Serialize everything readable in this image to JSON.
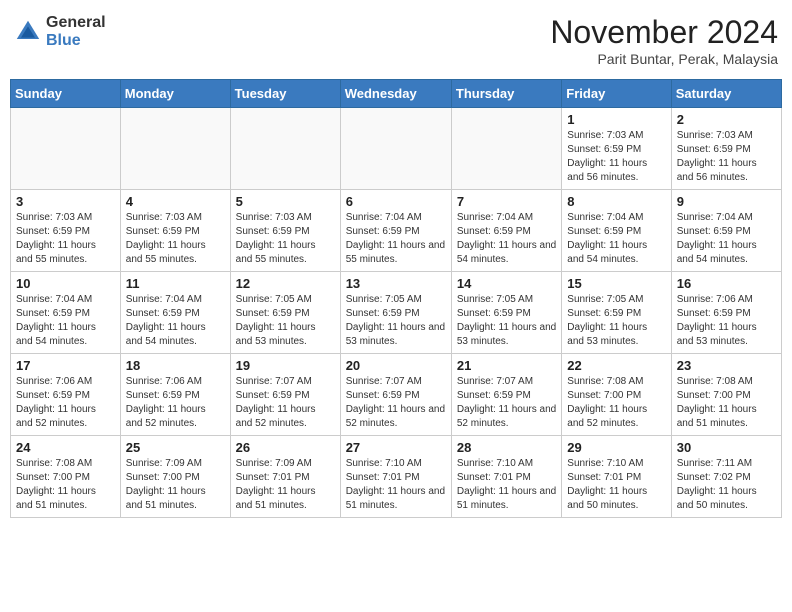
{
  "header": {
    "logo_general": "General",
    "logo_blue": "Blue",
    "title": "November 2024",
    "subtitle": "Parit Buntar, Perak, Malaysia"
  },
  "weekdays": [
    "Sunday",
    "Monday",
    "Tuesday",
    "Wednesday",
    "Thursday",
    "Friday",
    "Saturday"
  ],
  "weeks": [
    [
      {
        "day": "",
        "info": ""
      },
      {
        "day": "",
        "info": ""
      },
      {
        "day": "",
        "info": ""
      },
      {
        "day": "",
        "info": ""
      },
      {
        "day": "",
        "info": ""
      },
      {
        "day": "1",
        "info": "Sunrise: 7:03 AM\nSunset: 6:59 PM\nDaylight: 11 hours\nand 56 minutes."
      },
      {
        "day": "2",
        "info": "Sunrise: 7:03 AM\nSunset: 6:59 PM\nDaylight: 11 hours\nand 56 minutes."
      }
    ],
    [
      {
        "day": "3",
        "info": "Sunrise: 7:03 AM\nSunset: 6:59 PM\nDaylight: 11 hours\nand 55 minutes."
      },
      {
        "day": "4",
        "info": "Sunrise: 7:03 AM\nSunset: 6:59 PM\nDaylight: 11 hours\nand 55 minutes."
      },
      {
        "day": "5",
        "info": "Sunrise: 7:03 AM\nSunset: 6:59 PM\nDaylight: 11 hours\nand 55 minutes."
      },
      {
        "day": "6",
        "info": "Sunrise: 7:04 AM\nSunset: 6:59 PM\nDaylight: 11 hours\nand 55 minutes."
      },
      {
        "day": "7",
        "info": "Sunrise: 7:04 AM\nSunset: 6:59 PM\nDaylight: 11 hours\nand 54 minutes."
      },
      {
        "day": "8",
        "info": "Sunrise: 7:04 AM\nSunset: 6:59 PM\nDaylight: 11 hours\nand 54 minutes."
      },
      {
        "day": "9",
        "info": "Sunrise: 7:04 AM\nSunset: 6:59 PM\nDaylight: 11 hours\nand 54 minutes."
      }
    ],
    [
      {
        "day": "10",
        "info": "Sunrise: 7:04 AM\nSunset: 6:59 PM\nDaylight: 11 hours\nand 54 minutes."
      },
      {
        "day": "11",
        "info": "Sunrise: 7:04 AM\nSunset: 6:59 PM\nDaylight: 11 hours\nand 54 minutes."
      },
      {
        "day": "12",
        "info": "Sunrise: 7:05 AM\nSunset: 6:59 PM\nDaylight: 11 hours\nand 53 minutes."
      },
      {
        "day": "13",
        "info": "Sunrise: 7:05 AM\nSunset: 6:59 PM\nDaylight: 11 hours\nand 53 minutes."
      },
      {
        "day": "14",
        "info": "Sunrise: 7:05 AM\nSunset: 6:59 PM\nDaylight: 11 hours\nand 53 minutes."
      },
      {
        "day": "15",
        "info": "Sunrise: 7:05 AM\nSunset: 6:59 PM\nDaylight: 11 hours\nand 53 minutes."
      },
      {
        "day": "16",
        "info": "Sunrise: 7:06 AM\nSunset: 6:59 PM\nDaylight: 11 hours\nand 53 minutes."
      }
    ],
    [
      {
        "day": "17",
        "info": "Sunrise: 7:06 AM\nSunset: 6:59 PM\nDaylight: 11 hours\nand 52 minutes."
      },
      {
        "day": "18",
        "info": "Sunrise: 7:06 AM\nSunset: 6:59 PM\nDaylight: 11 hours\nand 52 minutes."
      },
      {
        "day": "19",
        "info": "Sunrise: 7:07 AM\nSunset: 6:59 PM\nDaylight: 11 hours\nand 52 minutes."
      },
      {
        "day": "20",
        "info": "Sunrise: 7:07 AM\nSunset: 6:59 PM\nDaylight: 11 hours\nand 52 minutes."
      },
      {
        "day": "21",
        "info": "Sunrise: 7:07 AM\nSunset: 6:59 PM\nDaylight: 11 hours\nand 52 minutes."
      },
      {
        "day": "22",
        "info": "Sunrise: 7:08 AM\nSunset: 7:00 PM\nDaylight: 11 hours\nand 52 minutes."
      },
      {
        "day": "23",
        "info": "Sunrise: 7:08 AM\nSunset: 7:00 PM\nDaylight: 11 hours\nand 51 minutes."
      }
    ],
    [
      {
        "day": "24",
        "info": "Sunrise: 7:08 AM\nSunset: 7:00 PM\nDaylight: 11 hours\nand 51 minutes."
      },
      {
        "day": "25",
        "info": "Sunrise: 7:09 AM\nSunset: 7:00 PM\nDaylight: 11 hours\nand 51 minutes."
      },
      {
        "day": "26",
        "info": "Sunrise: 7:09 AM\nSunset: 7:01 PM\nDaylight: 11 hours\nand 51 minutes."
      },
      {
        "day": "27",
        "info": "Sunrise: 7:10 AM\nSunset: 7:01 PM\nDaylight: 11 hours\nand 51 minutes."
      },
      {
        "day": "28",
        "info": "Sunrise: 7:10 AM\nSunset: 7:01 PM\nDaylight: 11 hours\nand 51 minutes."
      },
      {
        "day": "29",
        "info": "Sunrise: 7:10 AM\nSunset: 7:01 PM\nDaylight: 11 hours\nand 50 minutes."
      },
      {
        "day": "30",
        "info": "Sunrise: 7:11 AM\nSunset: 7:02 PM\nDaylight: 11 hours\nand 50 minutes."
      }
    ]
  ]
}
